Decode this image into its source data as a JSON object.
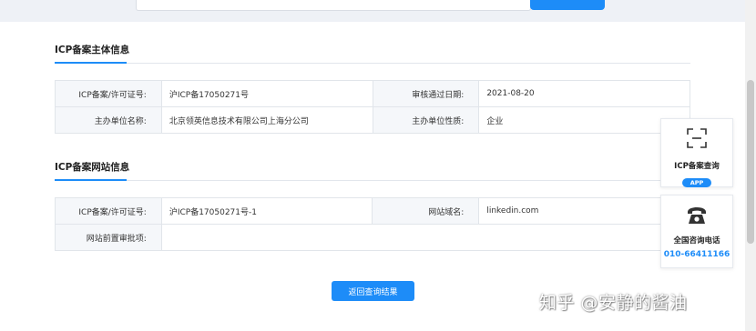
{
  "section1": {
    "title": "ICP备案主体信息",
    "rows": [
      {
        "label1": "ICP备案/许可证号:",
        "value1": "沪ICP备17050271号",
        "label2": "审核通过日期:",
        "value2": "2021-08-20"
      },
      {
        "label1": "主办单位名称:",
        "value1": "北京领英信息技术有限公司上海分公司",
        "label2": "主办单位性质:",
        "value2": "企业"
      }
    ]
  },
  "section2": {
    "title": "ICP备案网站信息",
    "rows": [
      {
        "label1": "ICP备案/许可证号:",
        "value1": "沪ICP备17050271号-1",
        "label2": "网站域名:",
        "value2": "linkedin.com"
      },
      {
        "label1": "网站前置审批项:",
        "value1": ""
      }
    ]
  },
  "return_button": "返回查询结果",
  "side_panel": {
    "icp_query": {
      "label": "ICP备案查询",
      "badge": "APP",
      "icon": "scan-icon"
    },
    "hotline": {
      "label": "全国咨询电话",
      "number": "010-66411166",
      "icon": "phone-icon"
    }
  },
  "watermark": "知乎 @安静的酱油",
  "colors": {
    "accent": "#1d8cf8",
    "label_bg": "#f5f7fa",
    "border": "#e1e5ea"
  }
}
